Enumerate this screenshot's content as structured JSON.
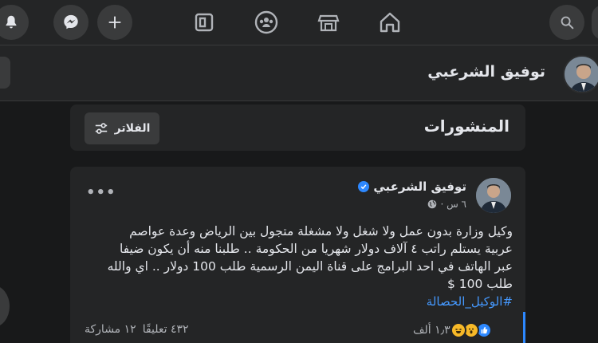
{
  "topbar": {
    "icons_right": [
      "search-icon",
      "home-icon",
      "marketplace-icon",
      "groups-icon",
      "gaming-icon"
    ],
    "icons_left": [
      "plus-icon",
      "messenger-icon",
      "notifications-icon"
    ]
  },
  "profile": {
    "name": "توفيق الشرعبي"
  },
  "posts_section": {
    "title": "المنشورات",
    "filter_label": "الفلاتر"
  },
  "post": {
    "author": "توفيق الشرعبي",
    "time": "٦ س ·",
    "text_lines": [
      "وكيل وزارة بدون عمل ولا شغل ولا مشغلة متجول بين الرياض وعدة عواصم",
      "عربية يستلم راتب ٤ آلاف دولار شهريا من الحكومة .. طلبنا منه أن يكون ضيفا",
      "عبر الهاتف في احد البرامج على قناة اليمن الرسمية طلب 100 دولار .. اي والله",
      "طلب 100 $"
    ],
    "hashtag": "#الوكيل_الحصالة",
    "reactions_count": "١٫٣ ألف",
    "comments": "٤٣٢ تعليقًا",
    "shares": "١٢ مشاركة"
  },
  "colors": {
    "background": "#18191a",
    "card": "#242526",
    "accent": "#2d88ff",
    "link": "#4599ff"
  }
}
